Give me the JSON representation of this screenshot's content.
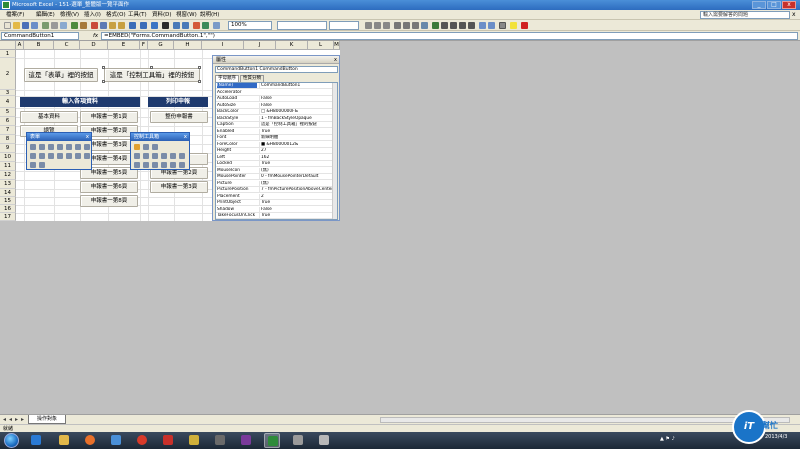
{
  "window": {
    "title": "Microsoft Excel - 151-選單_整體版一覽平面作",
    "min": "_",
    "max": "□",
    "close": "x"
  },
  "menu": {
    "items": [
      "檔案(F)",
      "編輯(E)",
      "檢視(V)",
      "插入(I)",
      "格式(O)",
      "工具(T)",
      "資料(D)",
      "視窗(W)",
      "說明(H)"
    ],
    "help_placeholder": "輸入需要解答的問題",
    "close": "x"
  },
  "toolbar": {
    "zoom": "100%",
    "font": "",
    "size": ""
  },
  "formula": {
    "name_box": "CommandButton1",
    "fx": "fx",
    "content": "=EMBED(\"Forms.CommandButton.1\",\"\")"
  },
  "sheet": {
    "columns": [
      "A",
      "B",
      "C",
      "D",
      "E",
      "F",
      "G",
      "H",
      "I",
      "J",
      "K",
      "L",
      "M"
    ],
    "rows": [
      "1",
      "2",
      "3",
      "4",
      "5",
      "6",
      "7",
      "8",
      "9",
      "10",
      "11",
      "12",
      "13",
      "14",
      "15",
      "16",
      "17"
    ],
    "button_forms": "這是「表單」裡的按鈕",
    "button_control": "這是「控制工具箱」裡的按鈕",
    "header_input": "輸入各項資料",
    "header_print": "列印申報",
    "btn_basic": "基本資料",
    "btn_f1": "申報書一第1頁",
    "btn_f2": "申報書一第2頁",
    "btn_f3": "申報書一第3頁",
    "btn_f4": "申報書一第4頁",
    "btn_f5": "申報書一第5頁",
    "btn_f6": "申報書一第6頁",
    "btn_f8": "申報書一第8頁",
    "btn_print_all": "整份申報書",
    "btn_p2": "申報書一第2頁",
    "btn_p3": "申報書一第3頁",
    "btn_misc": "總覽",
    "btn_partial": "總申報表"
  },
  "float_forms": {
    "title": "表單",
    "close": "x"
  },
  "float_control": {
    "title": "控制工具箱",
    "close": "x"
  },
  "properties": {
    "title": "屬性",
    "close": "x",
    "object": "CommandButton1 CommandButton",
    "tab_alpha": "字母順序",
    "tab_category": "性質分類",
    "rows": [
      {
        "name": "(Name)",
        "value": "CommandButton1"
      },
      {
        "name": "Accelerator",
        "value": ""
      },
      {
        "name": "AutoLoad",
        "value": "False"
      },
      {
        "name": "AutoSize",
        "value": "False"
      },
      {
        "name": "BackColor",
        "value": "□ &H8000000F&"
      },
      {
        "name": "BackStyle",
        "value": "1 - fmBackStyleOpaque"
      },
      {
        "name": "Caption",
        "value": "這是「控制工具箱」裡的按鈕"
      },
      {
        "name": "Enabled",
        "value": "True"
      },
      {
        "name": "Font",
        "value": "新細明體"
      },
      {
        "name": "ForeColor",
        "value": "■ &H80000012&"
      },
      {
        "name": "Height",
        "value": "27"
      },
      {
        "name": "Left",
        "value": "162"
      },
      {
        "name": "Locked",
        "value": "True"
      },
      {
        "name": "MouseIcon",
        "value": "(無)"
      },
      {
        "name": "MousePointer",
        "value": "0 - fmMousePointerDefault"
      },
      {
        "name": "Picture",
        "value": "(無)"
      },
      {
        "name": "PicturePosition",
        "value": "7 - fmPicturePositionAboveCenter"
      },
      {
        "name": "Placement",
        "value": "2"
      },
      {
        "name": "PrintObject",
        "value": "True"
      },
      {
        "name": "Shadow",
        "value": "False"
      },
      {
        "name": "TakeFocusOnClick",
        "value": "True"
      }
    ]
  },
  "sheet_tab": "操作對象",
  "status": "就緒",
  "taskbar": {
    "clock_time": "",
    "clock_date": "2013/4/3"
  },
  "watermark": {
    "circle": "iT",
    "text": "幫忙"
  }
}
